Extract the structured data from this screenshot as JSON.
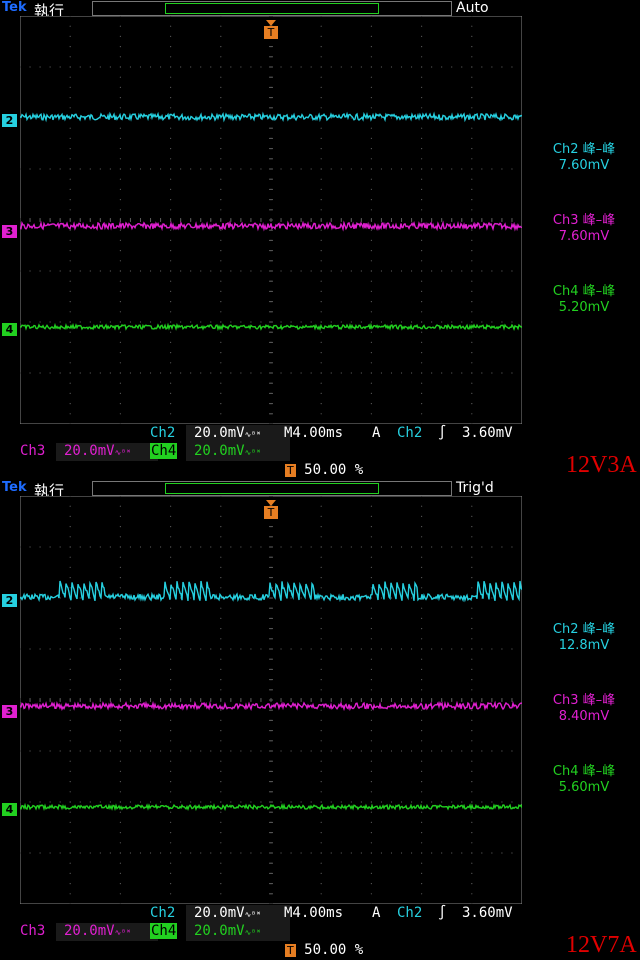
{
  "colors": {
    "ch2": "#26d0e0",
    "ch3": "#e020d0",
    "ch4": "#22d020",
    "trigger": "#e67e22",
    "grid": "#5a5a5a",
    "text": "#ffffff"
  },
  "panels": [
    {
      "brand": "Tek",
      "mode": "執行",
      "status": "Auto",
      "trigger_marker": "T",
      "channels": [
        {
          "id": "2"
        },
        {
          "id": "3"
        },
        {
          "id": "4"
        }
      ],
      "measurements": [
        {
          "label": "Ch2 峰–峰",
          "value": "7.60mV"
        },
        {
          "label": "Ch3 峰–峰",
          "value": "7.60mV"
        },
        {
          "label": "Ch4 峰–峰",
          "value": "5.20mV"
        }
      ],
      "bottom": {
        "ch2_label": "Ch2",
        "ch2_scale": "20.0mV",
        "timebase": "M4.00ms",
        "acq": "A",
        "trig_src": "Ch2",
        "trig_level": "3.60mV",
        "ch3_label": "Ch3",
        "ch3_scale": "20.0mV",
        "ch4_label": "Ch4",
        "ch4_scale": "20.0mV",
        "trig_pos": "50.00 %",
        "bw_icon": "∿ᴮᵂ"
      },
      "tag": "12V3A"
    },
    {
      "brand": "Tek",
      "mode": "執行",
      "status": "Trig'd",
      "trigger_marker": "T",
      "channels": [
        {
          "id": "2"
        },
        {
          "id": "3"
        },
        {
          "id": "4"
        }
      ],
      "measurements": [
        {
          "label": "Ch2 峰–峰",
          "value": "12.8mV"
        },
        {
          "label": "Ch3 峰–峰",
          "value": "8.40mV"
        },
        {
          "label": "Ch4 峰–峰",
          "value": "5.60mV"
        }
      ],
      "bottom": {
        "ch2_label": "Ch2",
        "ch2_scale": "20.0mV",
        "timebase": "M4.00ms",
        "acq": "A",
        "trig_src": "Ch2",
        "trig_level": "3.60mV",
        "ch3_label": "Ch3",
        "ch3_scale": "20.0mV",
        "ch4_label": "Ch4",
        "ch4_scale": "20.0mV",
        "trig_pos": "50.00 %",
        "bw_icon": "∿ᴮᵂ"
      },
      "tag": "12V7A"
    }
  ]
}
